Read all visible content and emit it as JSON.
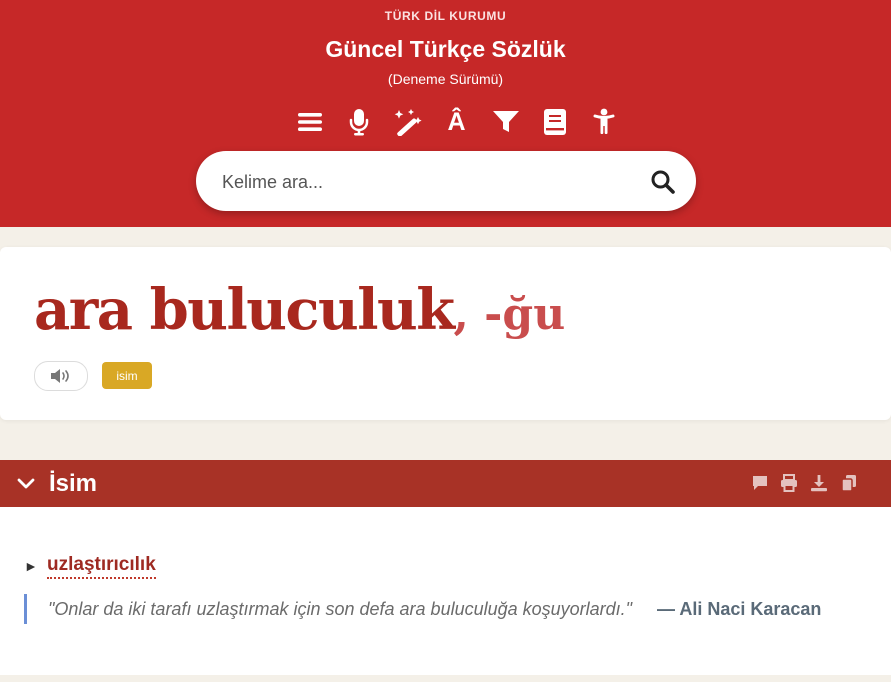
{
  "header": {
    "org": "TÜRK DİL KURUMU",
    "title": "Güncel Türkçe Sözlük",
    "subtitle": "(Deneme Sürümü)"
  },
  "toolbar": {
    "icons": [
      "menu-icon",
      "microphone-icon",
      "magic-wand-icon",
      "special-characters-icon",
      "filter-icon",
      "book-icon",
      "accessibility-icon"
    ],
    "special_char": "Â"
  },
  "search": {
    "placeholder": "Kelime ara...",
    "value": ""
  },
  "entry": {
    "word": "ara buluculuk",
    "suffix": ", -ğu",
    "part_of_speech": "isim"
  },
  "section": {
    "title": "İsim",
    "actions": [
      "comment-icon",
      "print-icon",
      "download-icon",
      "copy-icon"
    ]
  },
  "definition": {
    "marker": "►",
    "meaning": "uzlaştırıcılık",
    "example": "\"Onlar da iki tarafı uzlaştırmak için son defa ara buluculuğa koşuyorlardı.\"",
    "author": "— Ali Naci Karacan"
  },
  "colors": {
    "header_bg": "#c62828",
    "section_bg": "#a83226",
    "badge_bg": "#d9a825",
    "page_bg": "#f4f0e8"
  }
}
